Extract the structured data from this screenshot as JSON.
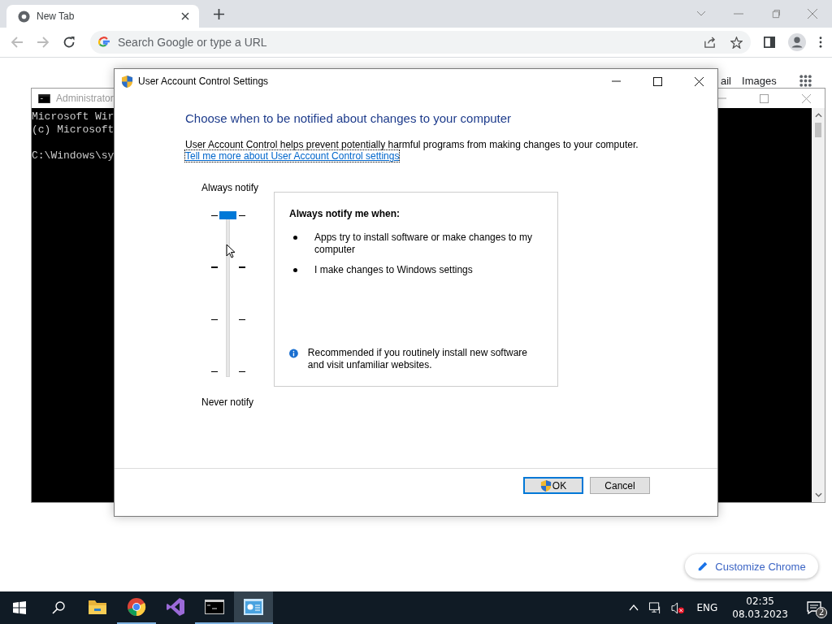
{
  "browser": {
    "tab": {
      "title": "New Tab",
      "selected": true
    },
    "omnibox": {
      "placeholder": "Search Google or type a URL"
    },
    "page_links": [
      "ail",
      "Images"
    ],
    "customize_button": "Customize Chrome"
  },
  "console_window": {
    "title": "Administrator",
    "paragraphs": [
      [
        "Microsoft Wir",
        "(c) Microsoft"
      ],
      [
        "C:\\Windows\\sy"
      ]
    ]
  },
  "dialog": {
    "title": "User Account Control Settings",
    "heading": "Choose when to be notified about changes to your computer",
    "description": "User Account Control helps prevent potentially harmful programs from making changes to your computer.",
    "link": "Tell me more about User Account Control settings",
    "slider": {
      "top_label": "Always notify",
      "bottom_label": "Never notify",
      "level": 1
    },
    "panel": {
      "heading": "Always notify me when:",
      "bullets": [
        "Apps try to install software or make changes to my computer",
        "I make changes to Windows settings"
      ],
      "note": "Recommended if you routinely install new software and visit unfamiliar websites."
    },
    "buttons": [
      {
        "label": "OK",
        "kind": "primary"
      },
      {
        "label": "Cancel",
        "kind": "normal"
      }
    ]
  },
  "taskbar": {
    "apps": [
      {
        "kind": "explorer",
        "running": false,
        "selected": false
      },
      {
        "kind": "chrome",
        "running": true,
        "selected": false
      },
      {
        "kind": "studio",
        "running": false,
        "selected": false
      },
      {
        "kind": "console",
        "running": true,
        "selected": false
      },
      {
        "kind": "uac",
        "running": true,
        "selected": true
      }
    ],
    "language": "ENG",
    "time": "02:35",
    "date": "08.03.2023",
    "notifications": "2"
  }
}
